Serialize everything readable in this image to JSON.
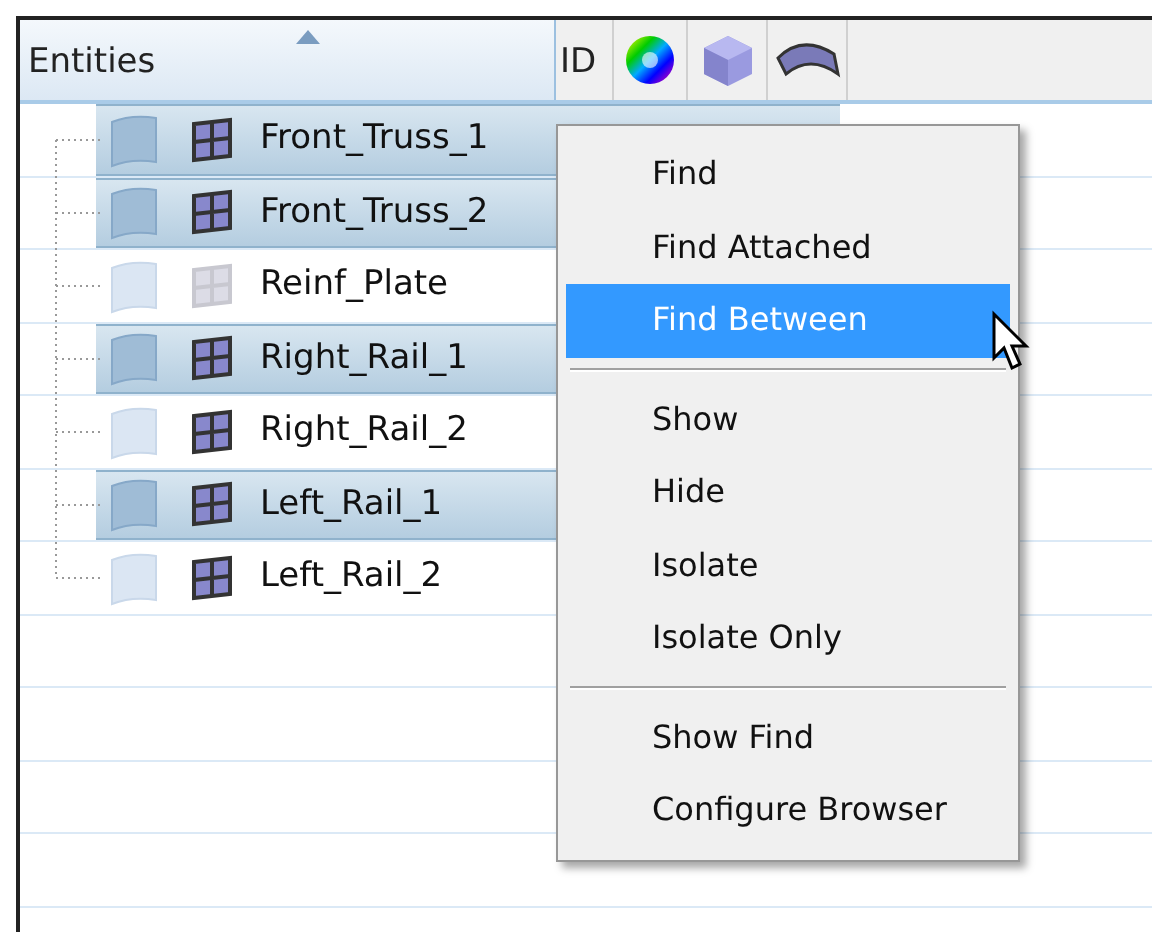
{
  "header": {
    "entities": "Entities",
    "id": "ID"
  },
  "rows": [
    {
      "name": "Front_Truss_1",
      "selected": true,
      "hidden": false
    },
    {
      "name": "Front_Truss_2",
      "selected": true,
      "hidden": false
    },
    {
      "name": "Reinf_Plate",
      "selected": false,
      "hidden": true
    },
    {
      "name": "Right_Rail_1",
      "selected": true,
      "hidden": false
    },
    {
      "name": "Right_Rail_2",
      "selected": false,
      "hidden": false
    },
    {
      "name": "Left_Rail_1",
      "selected": true,
      "hidden": false
    },
    {
      "name": "Left_Rail_2",
      "selected": false,
      "hidden": false
    }
  ],
  "context_menu": {
    "items": [
      {
        "kind": "item",
        "label": "Find",
        "selected": false
      },
      {
        "kind": "item",
        "label": "Find Attached",
        "selected": false
      },
      {
        "kind": "item",
        "label": "Find Between",
        "selected": true
      },
      {
        "kind": "separator"
      },
      {
        "kind": "item",
        "label": "Show",
        "selected": false
      },
      {
        "kind": "item",
        "label": "Hide",
        "selected": false
      },
      {
        "kind": "item",
        "label": "Isolate",
        "selected": false
      },
      {
        "kind": "item",
        "label": "Isolate Only",
        "selected": false
      },
      {
        "kind": "separator"
      },
      {
        "kind": "item",
        "label": "Show Find",
        "selected": false
      },
      {
        "kind": "item",
        "label": "Configure Browser",
        "selected": false
      }
    ]
  }
}
